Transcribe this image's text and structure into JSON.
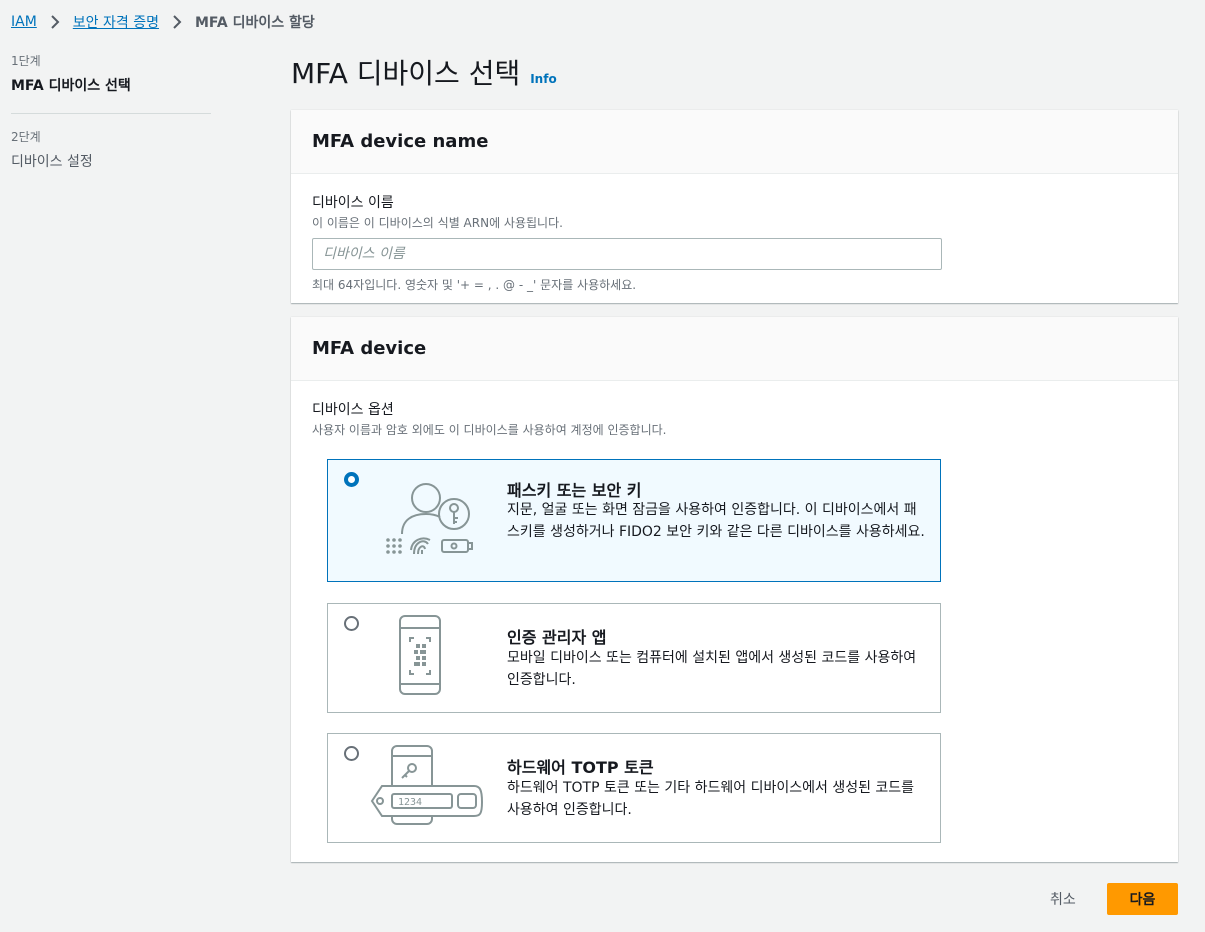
{
  "breadcrumb": {
    "items": [
      "IAM",
      "보안 자격 증명"
    ],
    "current": "MFA 디바이스 할당"
  },
  "steps": [
    {
      "number": "1단계",
      "title": "MFA 디바이스 선택"
    },
    {
      "number": "2단계",
      "title": "디바이스 설정"
    }
  ],
  "page": {
    "title": "MFA 디바이스 선택",
    "info": "Info"
  },
  "device_name_panel": {
    "header": "MFA device name",
    "label": "디바이스 이름",
    "description": "이 이름은 이 디바이스의 식별 ARN에 사용됩니다.",
    "placeholder": "디바이스 이름",
    "value": "",
    "constraint": "최대 64자입니다. 영숫자 및 '+ = , . @ - _' 문자를 사용하세요."
  },
  "device_panel": {
    "header": "MFA device",
    "label": "디바이스 옵션",
    "description": "사용자 이름과 암호 외에도 이 디바이스를 사용하여 계정에 인증합니다.",
    "options": [
      {
        "title": "패스키 또는 보안 키",
        "description": "지문, 얼굴 또는 화면 잠금을 사용하여 인증합니다. 이 디바이스에서 패스키를 생성하거나 FIDO2 보안 키와 같은 다른 디바이스를 사용하세요.",
        "selected": true,
        "icon": "passkey-illustration-icon"
      },
      {
        "title": "인증 관리자 앱",
        "description": "모바일 디바이스 또는 컴퓨터에 설치된 앱에서 생성된 코드를 사용하여 인증합니다.",
        "selected": false,
        "icon": "authenticator-app-illustration-icon"
      },
      {
        "title": "하드웨어 TOTP 토큰",
        "description": "하드웨어 TOTP 토큰 또는 기타 하드웨어 디바이스에서 생성된 코드를 사용하여 인증합니다.",
        "selected": false,
        "icon": "hardware-token-illustration-icon",
        "token_display": "1234"
      }
    ]
  },
  "footer": {
    "cancel": "취소",
    "next": "다음"
  },
  "colors": {
    "link": "#0073bb",
    "primary_button": "#ff9900",
    "selected_tile_bg": "#f1faff"
  }
}
